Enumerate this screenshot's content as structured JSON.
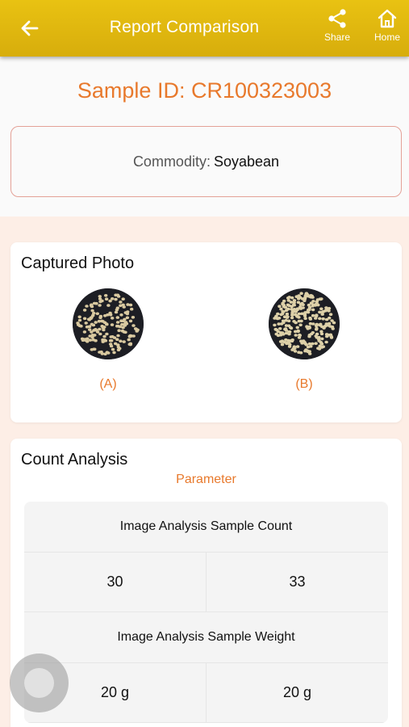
{
  "header": {
    "title": "Report Comparison",
    "share_label": "Share",
    "home_label": "Home"
  },
  "sample": {
    "id_text": "Sample ID: CR100323003",
    "commodity_label": "Commodity:",
    "commodity_value": "Soyabean"
  },
  "captured_photo": {
    "title": "Captured Photo",
    "photos": [
      {
        "caption": "(A)"
      },
      {
        "caption": "(B)"
      }
    ]
  },
  "count_analysis": {
    "title": "Count Analysis",
    "parameter_label": "Parameter",
    "rows": [
      {
        "parameter": "Image Analysis Sample Count",
        "a": "30",
        "b": "33"
      },
      {
        "parameter": "Image Analysis Sample Weight",
        "a": "20 g",
        "b": "20 g"
      }
    ]
  },
  "colors": {
    "app_bar": "#dcb40e",
    "accent": "#e8792c",
    "border": "#e4a197",
    "background": "#fdeee6"
  }
}
